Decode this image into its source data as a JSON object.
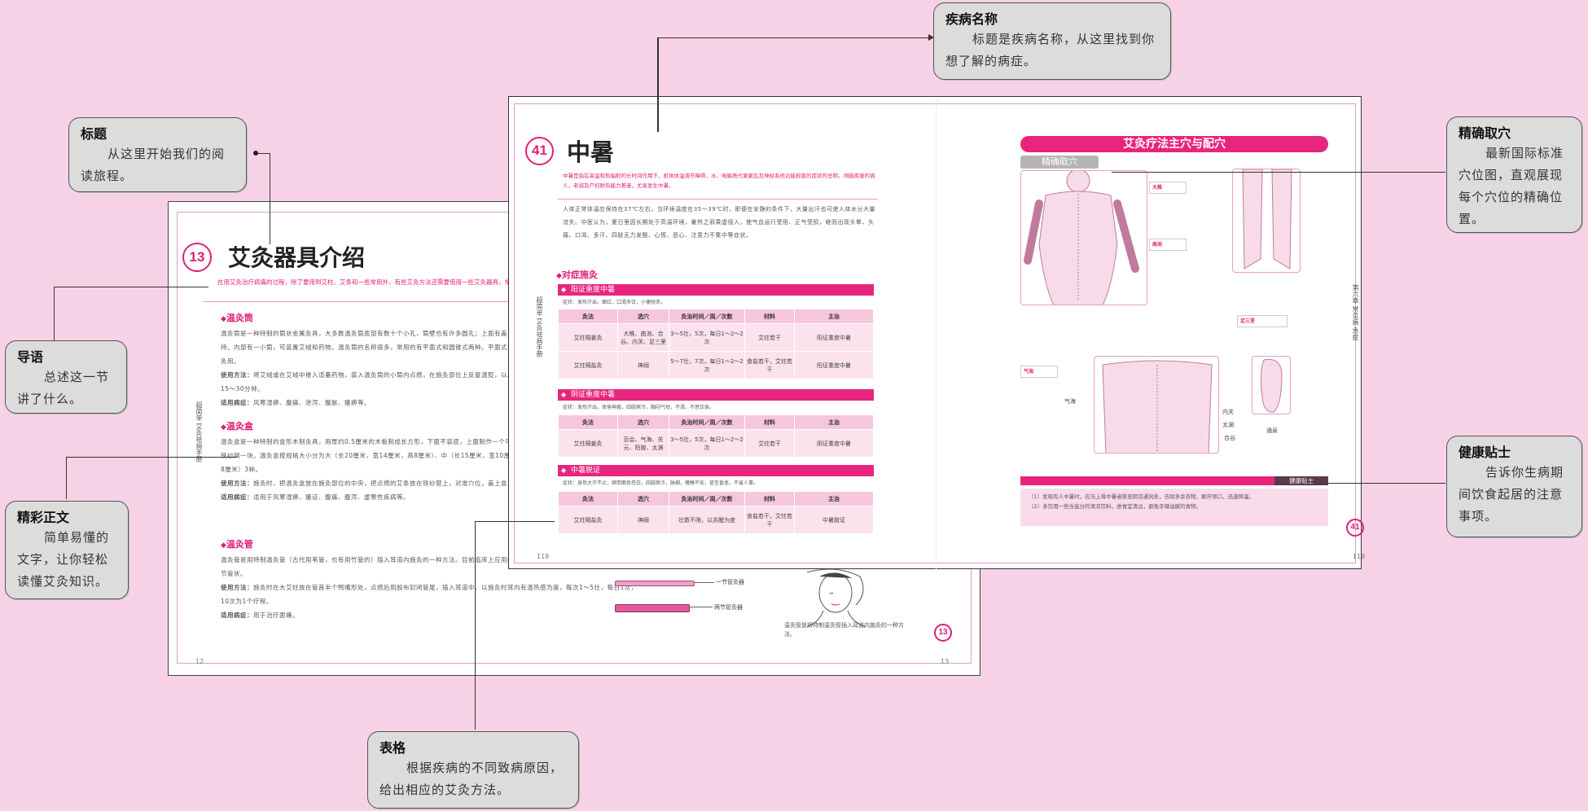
{
  "callouts": {
    "disease_name": {
      "title": "疾病名称",
      "body": "标题是疾病名称，从这里找到你想了解的病症。"
    },
    "title": {
      "title": "标题",
      "body": "从这里开始我们的阅读旅程。"
    },
    "intro": {
      "title": "导语",
      "body": "总述这一节讲了什么。"
    },
    "main_text": {
      "title": "精彩正文",
      "body": "简单易懂的文字，让你轻松读懂艾灸知识。"
    },
    "acupoint": {
      "title": "精确取穴",
      "body": "最新国际标准穴位图，直观展现每个穴位的精确位置。"
    },
    "health_tips": {
      "title": "健康贴士",
      "body": "告诉你生病期间饮食起居的注意事项。"
    },
    "table": {
      "title": "表格",
      "body": "根据疾病的不同致病原因，给出相应的艾灸方法。"
    }
  },
  "back_spread": {
    "number": "13",
    "title": "艾灸器具介绍",
    "intro": "在用艾灸治疗病痛的过程，除了要用到艾柱、艾条和一些常用外，有些艾灸方法还需要借用一些艾灸器具，常用的艾灸器具主要有：温灸筒、温灸盒、温灸管。",
    "sections": [
      {
        "heading": "温灸筒",
        "body": "温灸筒是一种特制的筒状金属灸具，大多数温灸筒底部有数十个小孔，筒壁也有许多圆孔；上面有盖，可以随时取下，筒壁上安有一长柄，便于手持。内部有一小筒，可装置艾绒和药物。温灸筒的名称很多，常用的有平面式和圆锥式两种。平面式适用于较大面积的灸治，圆锥式作为小面积的点灸用。",
        "use_label": "使用方法：",
        "use": "将艾绒或在艾绒中掺入适量药物，装入温灸筒的小筒内点燃，在施灸部位上反复温熨，以局部发热发红，患者感觉舒适为度，一般可灸15～30分钟。",
        "apply_label": "适用病症：",
        "apply": "风寒湿痹、腹痛、泄泻、腹胀、痿痹等。"
      },
      {
        "heading": "温灸盒",
        "body": "温灸盒是一种特制的盒形木制灸具，用厚约0.5厘米的木板制成长方形，下面不装底，上面制作一个可以取下的盒盖，在盒内距底边3～4厘米处安装铁纱网一块。温灸盒按规格大小分为大（长20厘米，宽14厘米，高8厘米）、中（长15厘米，宽10厘米，高8厘米）、小（长11厘米，宽9厘米，高8厘米）3种。",
        "use_label": "使用方法：",
        "use": "施灸时，把温灸盒放在施灸部位的中央，把点燃的艾条放在铁纱窗上，对准穴位，盖上盒盖灸15～30分钟。",
        "apply_label": "适用病症：",
        "apply": "适用于风寒湿痹、痿证、腹痛、腹泻、虚寒性疾病等。"
      },
      {
        "heading": "温灸管",
        "body": "温灸管是用特制温灸管（古代用苇管，也有用竹管的）插入耳道内施灸的一种方法。目前临床上应用的温灸管有两种：一种是一节管状，另一种是两节管状。",
        "use_label": "使用方法：",
        "use": "施灸时在大艾炷放在管首半个鸭嘴形处，点燃后用胶布封闭管尾，插入耳道中。以施灸时耳内有温热感为度，每次1～5壮，每日1次，10次为1个疗程。",
        "apply_label": "适用病症：",
        "apply": "用于治疗面瘫。"
      }
    ],
    "tube_labels": [
      "一节管灸器",
      "两节管灸器"
    ],
    "caption": "温灸管是将特制温灸管插入耳道内施灸的一种方法。",
    "side_tab": "超简单 艾灸祛病手册",
    "page_left": "12",
    "page_right": "13"
  },
  "front_spread": {
    "number": "41",
    "title": "中暑",
    "intro": "中暑是指在高温和热辐射的长时间作用下，机体体温调节障碍，水、电解质代谢紊乱及神经系统功能损害的症状的总称。颅脑疾患的病人，老弱及产妇耐热能力差者，尤易发生中暑。",
    "body": "人体正常体温应保持在37℃左右，当环境温度在35～39℃时，即便在安静的条件下，大量出汗也可使人体水分大量流失。中医认为，夏日里因长期处于高温环境，暑热之邪乘虚侵入，使气血运行受阻、正气受损，继而出现头晕、头痛、口渴、多汗、四肢无力发酸、心慌、恶心、注意力不集中等症状。",
    "section_heading": "对症施灸",
    "bars": [
      "阳证重度中暑",
      "阴证重度中暑",
      "中暑脱证"
    ],
    "bar_notes": [
      "症状：发热汗出，面红，口渴多饮，小便短赤。",
      "症状：发热汗出，体倦神疲，四肢厥冷，胸闷气短，不渴，不思饮食。",
      "症状：身热大汗不止，继而面色苍白，四肢厥冷，脉细，嗜睡不安，甚至昏迷，不省人事。"
    ],
    "table_headers": [
      "灸法",
      "选穴",
      "灸治时间／周／次数",
      "材料",
      "主治"
    ],
    "table_rows": [
      [
        "艾炷隔姜灸",
        "大椎、曲池、合谷、内关、足三里",
        "3～5壮，5次，每日1～2～2次",
        "艾炷若干",
        "阳证重度中暑"
      ],
      [
        "艾炷隔盐灸",
        "神阙",
        "5～7壮，7次，每日1～2～2次",
        "食盐若干，艾炷若干",
        "阳证重度中暑"
      ],
      [
        "艾炷隔姜灸",
        "百会、气海、关元、阳陵、太渊",
        "3～5壮，5次，每日1～2～2次",
        "艾炷若干",
        "阴证重度中暑"
      ],
      [
        "艾炷隔盐灸",
        "神阙",
        "壮数不限，以苏醒为度",
        "食盐若干，艾炷若干",
        "中暑脱证"
      ]
    ],
    "right_bar": "艾灸疗法主穴与配穴",
    "precise_label": "精确取穴",
    "point_labels": [
      "大椎",
      "曲池",
      "内关",
      "太渊",
      "合谷",
      "气海",
      "足三里",
      "涌泉"
    ],
    "tip_label": "健康贴士",
    "tip_lines": [
      "（1）发现有人中暑时，应马上将中暑者移至阴凉通风处，去除多余衣物，解开领口，迅速降温。",
      "（2）多饮用一些含盐分的清凉饮料，进食宜清淡，避免辛辣油腻的食物。"
    ],
    "side_tab": "第六章 常见病 急症",
    "page_left": "118",
    "page_right": "119",
    "corner_number": "41"
  },
  "colors": {
    "accent": "#e01e78",
    "background": "#f7d2e6",
    "callout_bg": "#dcdcdc"
  }
}
